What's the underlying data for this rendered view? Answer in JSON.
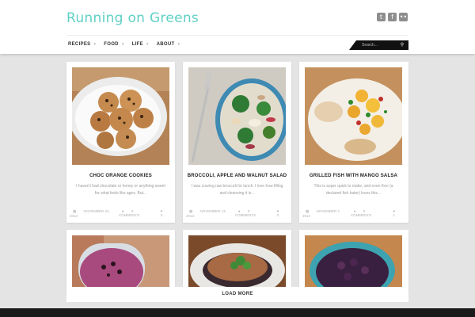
{
  "site": {
    "title": "Running on Greens"
  },
  "social": [
    {
      "name": "twitter-icon",
      "glyph": "t"
    },
    {
      "name": "facebook-icon",
      "glyph": "f"
    },
    {
      "name": "flickr-icon",
      "glyph": "••"
    }
  ],
  "nav": {
    "items": [
      "RECIPES",
      "FOOD",
      "LIFE",
      "ABOUT"
    ]
  },
  "search": {
    "placeholder": "Search..."
  },
  "posts": [
    {
      "title": "CHOC ORANGE COOKIES",
      "excerpt": "I haven't had chocolate or honey or anything sweet for what feels like ages. But...",
      "date": "NOVEMBER 24, 2013",
      "comments": "0 COMMENTS",
      "likes": "3"
    },
    {
      "title": "BROCCOLI, APPLE AND WALNUT SALAD",
      "excerpt": "I was craving raw broccoli for lunch. I love how filling and cleansing it is...",
      "date": "NOVEMBER 13, 2013",
      "comments": "0 COMMENTS",
      "likes": "0"
    },
    {
      "title": "GRILLED FISH WITH MANGO SALSA",
      "excerpt": "This is super quick to make, and even Ken (a declared fish hater) loves this...",
      "date": "NOVEMBER 7, 2013",
      "comments": "0 COMMENTS",
      "likes": "1"
    },
    {
      "title": "",
      "excerpt": "",
      "date": "",
      "comments": "",
      "likes": ""
    },
    {
      "title": "",
      "excerpt": "",
      "date": "",
      "comments": "",
      "likes": ""
    },
    {
      "title": "",
      "excerpt": "",
      "date": "",
      "comments": "",
      "likes": ""
    }
  ],
  "load_more": "LOAD MORE"
}
